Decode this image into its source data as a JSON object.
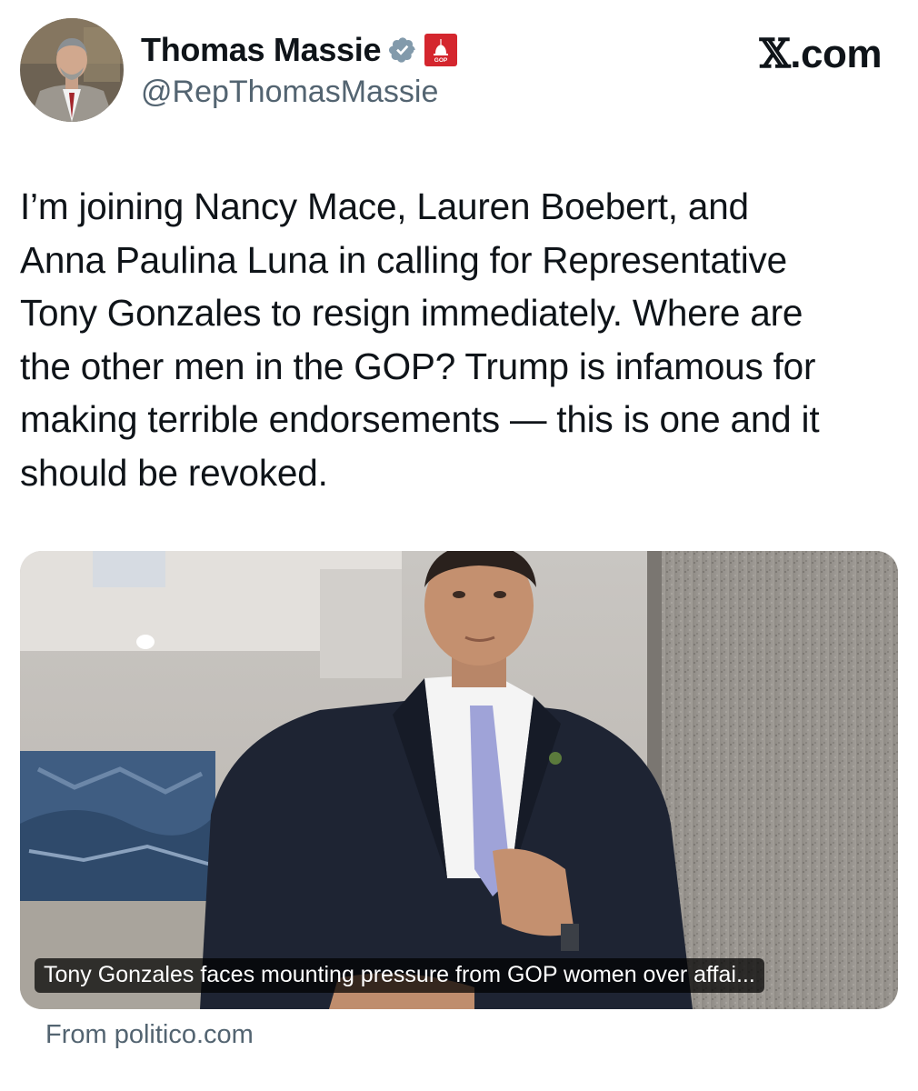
{
  "author": {
    "name": "Thomas Massie",
    "handle": "@RepThomasMassie",
    "verified_badge_icon": "verified-check-icon",
    "affiliation_badge_icon": "capitol-gop-badge-icon",
    "affiliation_badge_text": "GOP"
  },
  "site": {
    "label_x": "𝕏",
    "label_suffix": ".com"
  },
  "tweet": {
    "text_lines": [
      "I’m joining Nancy Mace, Lauren Boebert, and",
      "Anna Paulina Luna in calling for Representative",
      "Tony Gonzales to resign immediately. Where are",
      "the other men in the GOP? Trump is infamous for",
      "making terrible endorsements — this is one and it",
      "should be revoked."
    ]
  },
  "link_card": {
    "caption": "Tony Gonzales faces mounting pressure from GOP women over affai...",
    "source": "From politico.com"
  },
  "colors": {
    "text": "#0f1419",
    "secondary": "#536471",
    "verified": "#829aab",
    "gov_badge": "#d4262e"
  }
}
